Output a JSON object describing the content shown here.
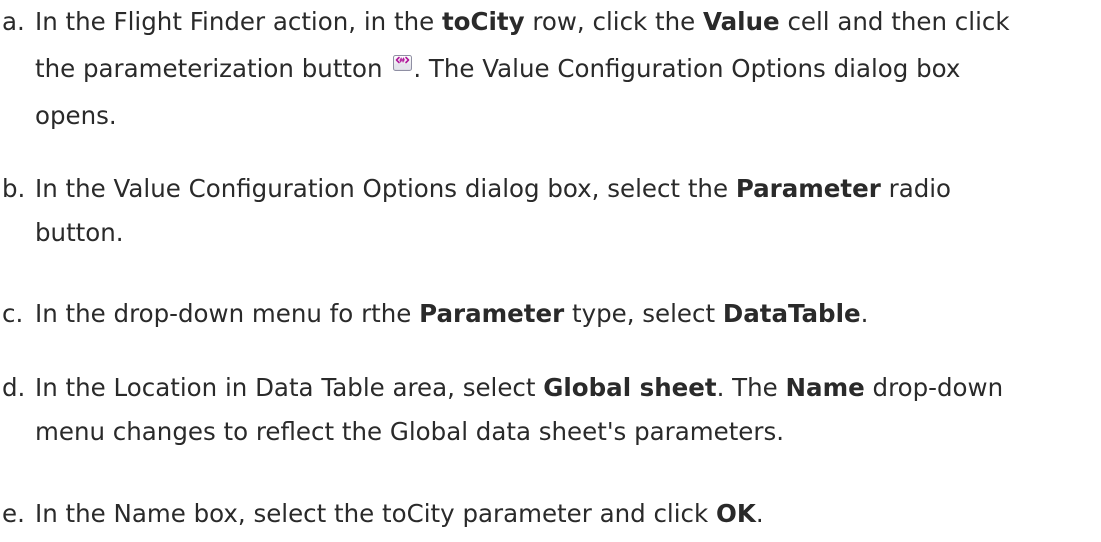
{
  "steps": [
    {
      "marker": "a.",
      "l1_t1": "In the Flight Finder action, in the ",
      "l1_b1": "toCity",
      "l1_t2": " row, click the ",
      "l1_b2": "Value",
      "l1_t3": " cell and then click",
      "l2_t1": "the parameterization button ",
      "l2_t2": ". The Value Configuration Options dialog box",
      "l3_t1": "opens.",
      "icon": "parameterization-icon"
    },
    {
      "marker": "b.",
      "l1_t1": "In the Value Configuration Options dialog box, select the ",
      "l1_b1": "Parameter",
      "l1_t2": " radio",
      "l2_t1": "button."
    },
    {
      "marker": "c.",
      "l1_t1": "In the drop-down menu fo rthe ",
      "l1_b1": "Parameter",
      "l1_t2": " type, select ",
      "l1_b2": "DataTable",
      "l1_t3": "."
    },
    {
      "marker": "d.",
      "l1_t1": "In the Location in Data Table area, select ",
      "l1_b1": "Global sheet",
      "l1_t2": ". The ",
      "l1_b2": "Name",
      "l1_t3": " drop-down",
      "l2_t1": "menu changes to reflect the Global data sheet's parameters."
    },
    {
      "marker": "e.",
      "l1_t1": "In the Name box, select the toCity parameter and click ",
      "l1_b1": "OK",
      "l1_t2": "."
    }
  ]
}
